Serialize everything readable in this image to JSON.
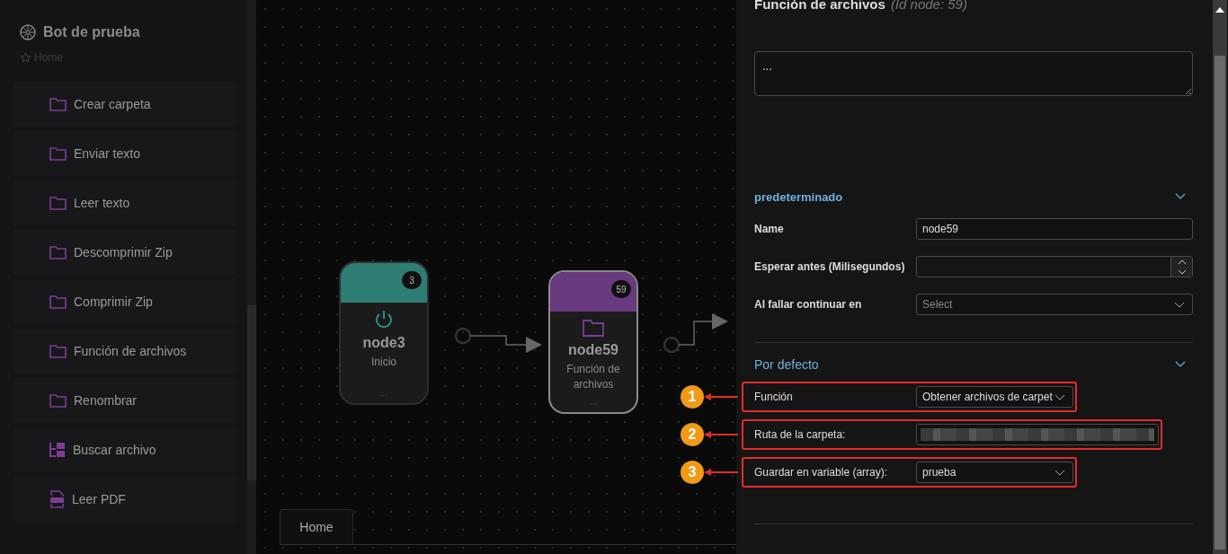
{
  "sidebar": {
    "title": "Bot de prueba",
    "breadcrumb": "Home",
    "items": [
      {
        "label": "Crear carpeta",
        "kind": "folder"
      },
      {
        "label": "Enviar texto",
        "kind": "folder"
      },
      {
        "label": "Leer texto",
        "kind": "folder"
      },
      {
        "label": "Descomprimir Zip",
        "kind": "folder"
      },
      {
        "label": "Comprimir Zip",
        "kind": "folder"
      },
      {
        "label": "Función de archivos",
        "kind": "folder"
      },
      {
        "label": "Renombrar",
        "kind": "folder"
      },
      {
        "label": "Buscar archivo",
        "kind": "tree"
      },
      {
        "label": "Leer PDF",
        "kind": "pdf"
      }
    ]
  },
  "canvas": {
    "nodes": [
      {
        "name": "node3",
        "subtitle": "Inicio",
        "badge": "3",
        "color": "#2e7d74",
        "kind": "power",
        "footer": "...",
        "selected": false
      },
      {
        "name": "node59",
        "subtitle": "Función de archivos",
        "badge": "59",
        "color": "#6a3a80",
        "kind": "folder",
        "footer": "...",
        "selected": true
      }
    ],
    "tabs": [
      {
        "label": "Home",
        "selected": true
      }
    ]
  },
  "panel": {
    "title": "Función de archivos",
    "id_label": "(Id node: 59)",
    "description": "...",
    "sections": [
      {
        "title": "predeterminado",
        "expanded": true,
        "fields": [
          {
            "kind": "text",
            "label": "Name",
            "value": "node59"
          },
          {
            "kind": "number",
            "label": "Esperar antes (Milisegundos)"
          },
          {
            "kind": "select",
            "label": "Al fallar continuar en",
            "placeholder": "Select"
          }
        ]
      },
      {
        "title": "Por defecto",
        "expanded": true,
        "fields": [
          {
            "kind": "select",
            "label": "Función",
            "value": "Obtener archivos de carpet",
            "callout": "1"
          },
          {
            "kind": "redacted",
            "label": "Ruta de la carpeta:",
            "callout": "2"
          },
          {
            "kind": "select",
            "label": "Guardar en variable (array):",
            "value": "prueba",
            "callout": "3"
          }
        ]
      }
    ]
  }
}
